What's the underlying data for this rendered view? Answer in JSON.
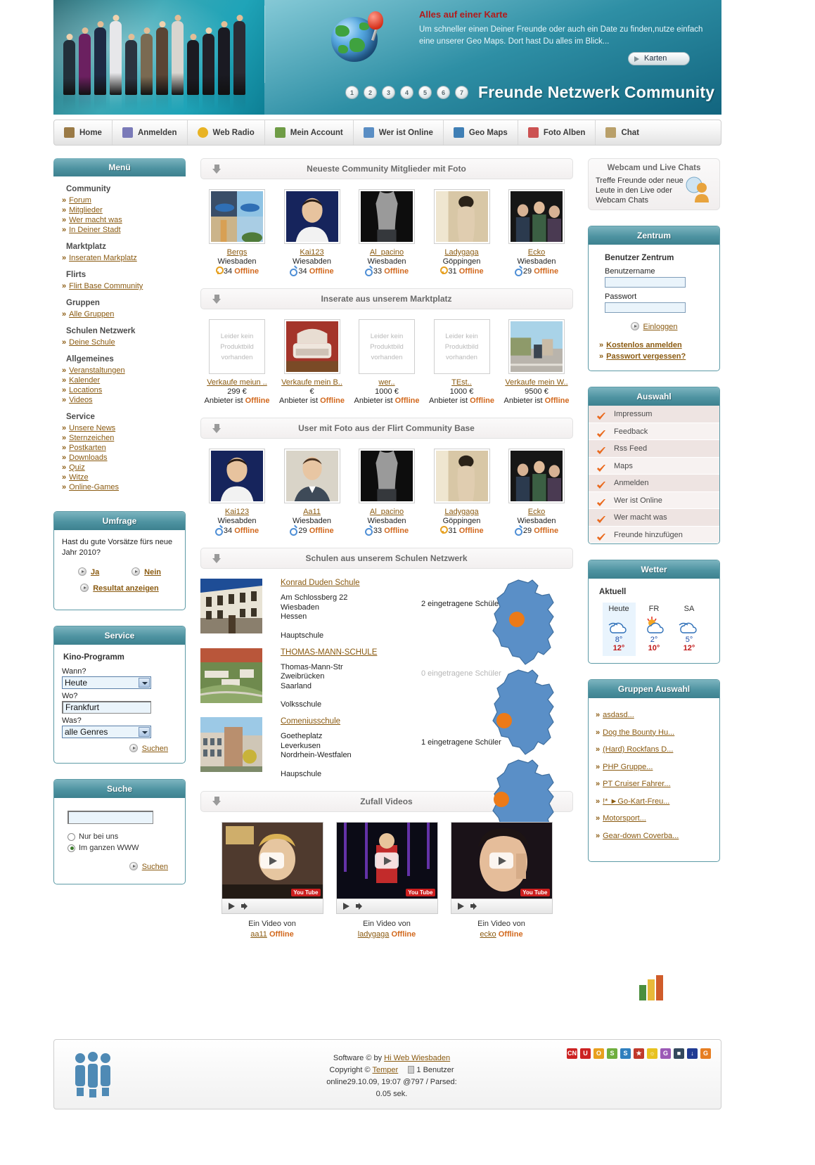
{
  "header": {
    "promo_title": "Alles auf einer Karte",
    "promo_text": "Um schneller einen Deiner Freunde oder auch ein Date zu finden,nutze einfach eine unserer Geo Maps. Dort hast Du alles im Blick...",
    "maps_button": "Karten",
    "site_title": "Freunde Netzwerk Community",
    "dots": [
      "1",
      "2",
      "3",
      "4",
      "5",
      "6",
      "7"
    ]
  },
  "nav": [
    {
      "label": "Home",
      "icon": "home-icon",
      "color": "#9a7a46"
    },
    {
      "label": "Anmelden",
      "icon": "key-icon",
      "color": "#7a7ab8"
    },
    {
      "label": "Web Radio",
      "icon": "star-icon",
      "color": "#e8b324"
    },
    {
      "label": "Mein Account",
      "icon": "user-icon",
      "color": "#6f9c46"
    },
    {
      "label": "Wer ist Online",
      "icon": "car-icon",
      "color": "#5a8ec4"
    },
    {
      "label": "Geo Maps",
      "icon": "map-icon",
      "color": "#3f7fb5"
    },
    {
      "label": "Foto Alben",
      "icon": "photo-icon",
      "color": "#cc5252"
    },
    {
      "label": "Chat",
      "icon": "chat-icon",
      "color": "#b9a06a"
    }
  ],
  "menu": {
    "title": "Menü",
    "groups": [
      {
        "title": "Community",
        "links": [
          "Forum",
          "Mitglieder",
          "Wer macht was",
          "In Deiner Stadt"
        ]
      },
      {
        "title": "Marktplatz",
        "links": [
          "Inseraten Markplatz"
        ]
      },
      {
        "title": "Flirts",
        "links": [
          "Flirt Base Community"
        ]
      },
      {
        "title": "Gruppen",
        "links": [
          "Alle Gruppen"
        ]
      },
      {
        "title": "Schulen Netzwerk",
        "links": [
          "Deine Schule"
        ]
      },
      {
        "title": "Allgemeines",
        "links": [
          "Veranstaltungen",
          "Kalender",
          "Locations",
          "Videos"
        ]
      },
      {
        "title": "Service",
        "links": [
          "Unsere News",
          "Sternzeichen",
          "Postkarten",
          "Downloads",
          "Quiz",
          "Witze",
          "Online-Games"
        ]
      }
    ]
  },
  "umfrage": {
    "title": "Umfrage",
    "question": "Hast du gute Vorsätze fürs neue Jahr 2010?",
    "yes": "Ja",
    "no": "Nein",
    "result": "Resultat anzeigen"
  },
  "service": {
    "title": "Service",
    "subtitle": "Kino-Programm",
    "when_label": "Wann?",
    "when_value": "Heute",
    "where_label": "Wo?",
    "where_value": "Frankfurt",
    "what_label": "Was?",
    "what_value": "alle Genres",
    "search_button": "Suchen"
  },
  "suche": {
    "title": "Suche",
    "input_value": "",
    "option_local": "Nur bei uns",
    "option_web": "Im ganzen WWW",
    "search_button": "Suchen"
  },
  "sections": {
    "members": "Neueste Community Mitglieder mit Foto",
    "market": "Inserate aus unserem Marktplatz",
    "flirt": "User mit Foto aus der Flirt Community Base",
    "schools": "Schulen aus unserem Schulen Netzwerk",
    "videos": "Zufall Videos"
  },
  "members": [
    {
      "name": "Bergs",
      "city": "Wiesbaden",
      "age": "34",
      "status": "Offline",
      "gender": "female",
      "photo": "collage"
    },
    {
      "name": "Kai123",
      "city": "Wiesabden",
      "age": "34",
      "status": "Offline",
      "gender": "male",
      "photo": "portrait-boy"
    },
    {
      "name": "Al_pacino",
      "city": "Wiesbaden",
      "age": "33",
      "status": "Offline",
      "gender": "male",
      "photo": "torso-bw"
    },
    {
      "name": "Ladygaga",
      "city": "Göppingen",
      "age": "31",
      "status": "Offline",
      "gender": "female",
      "photo": "woman-sepia"
    },
    {
      "name": "Ecko",
      "city": "Wiesbaden",
      "age": "29",
      "status": "Offline",
      "gender": "male",
      "photo": "party-dark"
    }
  ],
  "market": [
    {
      "title": "Verkaufe meiun ..",
      "price": "299 €",
      "seller_label": "Anbieter ist",
      "status": "Offline",
      "photo": "none",
      "noimg": "Leider kein Produktbild vorhanden"
    },
    {
      "title": "Verkaufe mein B..",
      "price": "€",
      "seller_label": "Anbieter ist",
      "status": "Offline",
      "photo": "bed",
      "noimg": ""
    },
    {
      "title": "wer..",
      "price": "1000 €",
      "seller_label": "Anbieter ist",
      "status": "Offline",
      "photo": "none",
      "noimg": "Leider kein Produktbild vorhanden"
    },
    {
      "title": "TEst..",
      "price": "1000 €",
      "seller_label": "Anbieter ist",
      "status": "Offline",
      "photo": "none",
      "noimg": "Leider kein Produktbild vorhanden"
    },
    {
      "title": "Verkaufe mein W..",
      "price": "9500 €",
      "seller_label": "Anbieter ist",
      "status": "Offline",
      "photo": "street",
      "noimg": ""
    }
  ],
  "flirt": [
    {
      "name": "Kai123",
      "city": "Wiesabden",
      "age": "34",
      "status": "Offline",
      "gender": "male",
      "photo": "portrait-boy"
    },
    {
      "name": "Aa11",
      "city": "Wiesbaden",
      "age": "29",
      "status": "Offline",
      "gender": "male",
      "photo": "portrait-man"
    },
    {
      "name": "Al_pacino",
      "city": "Wiesbaden",
      "age": "33",
      "status": "Offline",
      "gender": "male",
      "photo": "torso-bw"
    },
    {
      "name": "Ladygaga",
      "city": "Göppingen",
      "age": "31",
      "status": "Offline",
      "gender": "female",
      "photo": "woman-sepia"
    },
    {
      "name": "Ecko",
      "city": "Wiesbaden",
      "age": "29",
      "status": "Offline",
      "gender": "male",
      "photo": "party-dark"
    }
  ],
  "schools": [
    {
      "name": "Konrad Duden Schule",
      "street": "Am Schlossberg 22",
      "city": "Wiesbaden",
      "state": "Hessen",
      "type": "Hauptschule",
      "count": "2 eingetragene Schüler",
      "photo": "old-building"
    },
    {
      "name": "THOMAS-MANN-SCHULE",
      "street": "Thomas-Mann-Str",
      "city": "Zweibrücken",
      "state": "Saarland",
      "type": "Volksschule",
      "count": "0 eingetragene Schüler",
      "photo": "aerial"
    },
    {
      "name": "Comeniusschule",
      "street": "Goetheplatz",
      "city": "Leverkusen",
      "state": "Nordrhein-Westfalen",
      "type": "Haupschule",
      "count": "1 eingetragene Schüler",
      "photo": "modern-building"
    }
  ],
  "videos": [
    {
      "caption": "Ein Video von",
      "user": "aa11",
      "status": "Offline",
      "brand": "You Tube"
    },
    {
      "caption": "Ein Video von",
      "user": "ladygaga",
      "status": "Offline",
      "brand": "You Tube"
    },
    {
      "caption": "Ein Video von",
      "user": "ecko",
      "status": "Offline",
      "brand": "You Tube"
    }
  ],
  "webcam": {
    "title": "Webcam und Live Chats",
    "text": "Treffe Freunde oder neue Leute in den Live oder Webcam Chats"
  },
  "zentrum": {
    "title": "Zentrum",
    "subtitle": "Benutzer Zentrum",
    "user_label": "Benutzername",
    "user_value": "",
    "pass_label": "Passwort",
    "pass_value": "",
    "login": "Einloggen",
    "register": "Kostenlos anmelden",
    "forgot": "Passwort vergessen?"
  },
  "auswahl": {
    "title": "Auswahl",
    "items": [
      "Impressum",
      "Feedback",
      "Rss Feed",
      "Maps",
      "Anmelden",
      "Wer ist Online",
      "Wer macht was",
      "Freunde hinzufügen"
    ]
  },
  "wetter": {
    "title": "Wetter",
    "now_label": "Aktuell",
    "days": [
      {
        "name": "Heute",
        "icon": "cloudy",
        "low": "8°",
        "high": "12°"
      },
      {
        "name": "FR",
        "icon": "partly",
        "low": "2°",
        "high": "10°"
      },
      {
        "name": "SA",
        "icon": "cloudy",
        "low": "5°",
        "high": "12°"
      }
    ]
  },
  "gruppen": {
    "title": "Gruppen Auswahl",
    "items": [
      "asdasd...",
      "Dog the Bounty Hu...",
      "(Hard) Rockfans D...",
      "PHP Gruppe...",
      "PT Cruiser Fahrer...",
      "!* ►Go-Kart-Freu...",
      "Motorsport...",
      "Gear-down Coverba..."
    ]
  },
  "footer": {
    "software": "Software © by",
    "software_link": "Hi Web Wiesbaden",
    "copyright": "Copyright ©",
    "copyright_link": "Temper",
    "users": "1 Benutzer",
    "stats": "online29.10.09, 19:07 @797 / Parsed:",
    "parse": "0.05 sek.",
    "icons": [
      "CN",
      "U",
      "O",
      "S",
      "S",
      "★",
      "☼",
      "G",
      "■",
      "↓",
      "G"
    ]
  }
}
